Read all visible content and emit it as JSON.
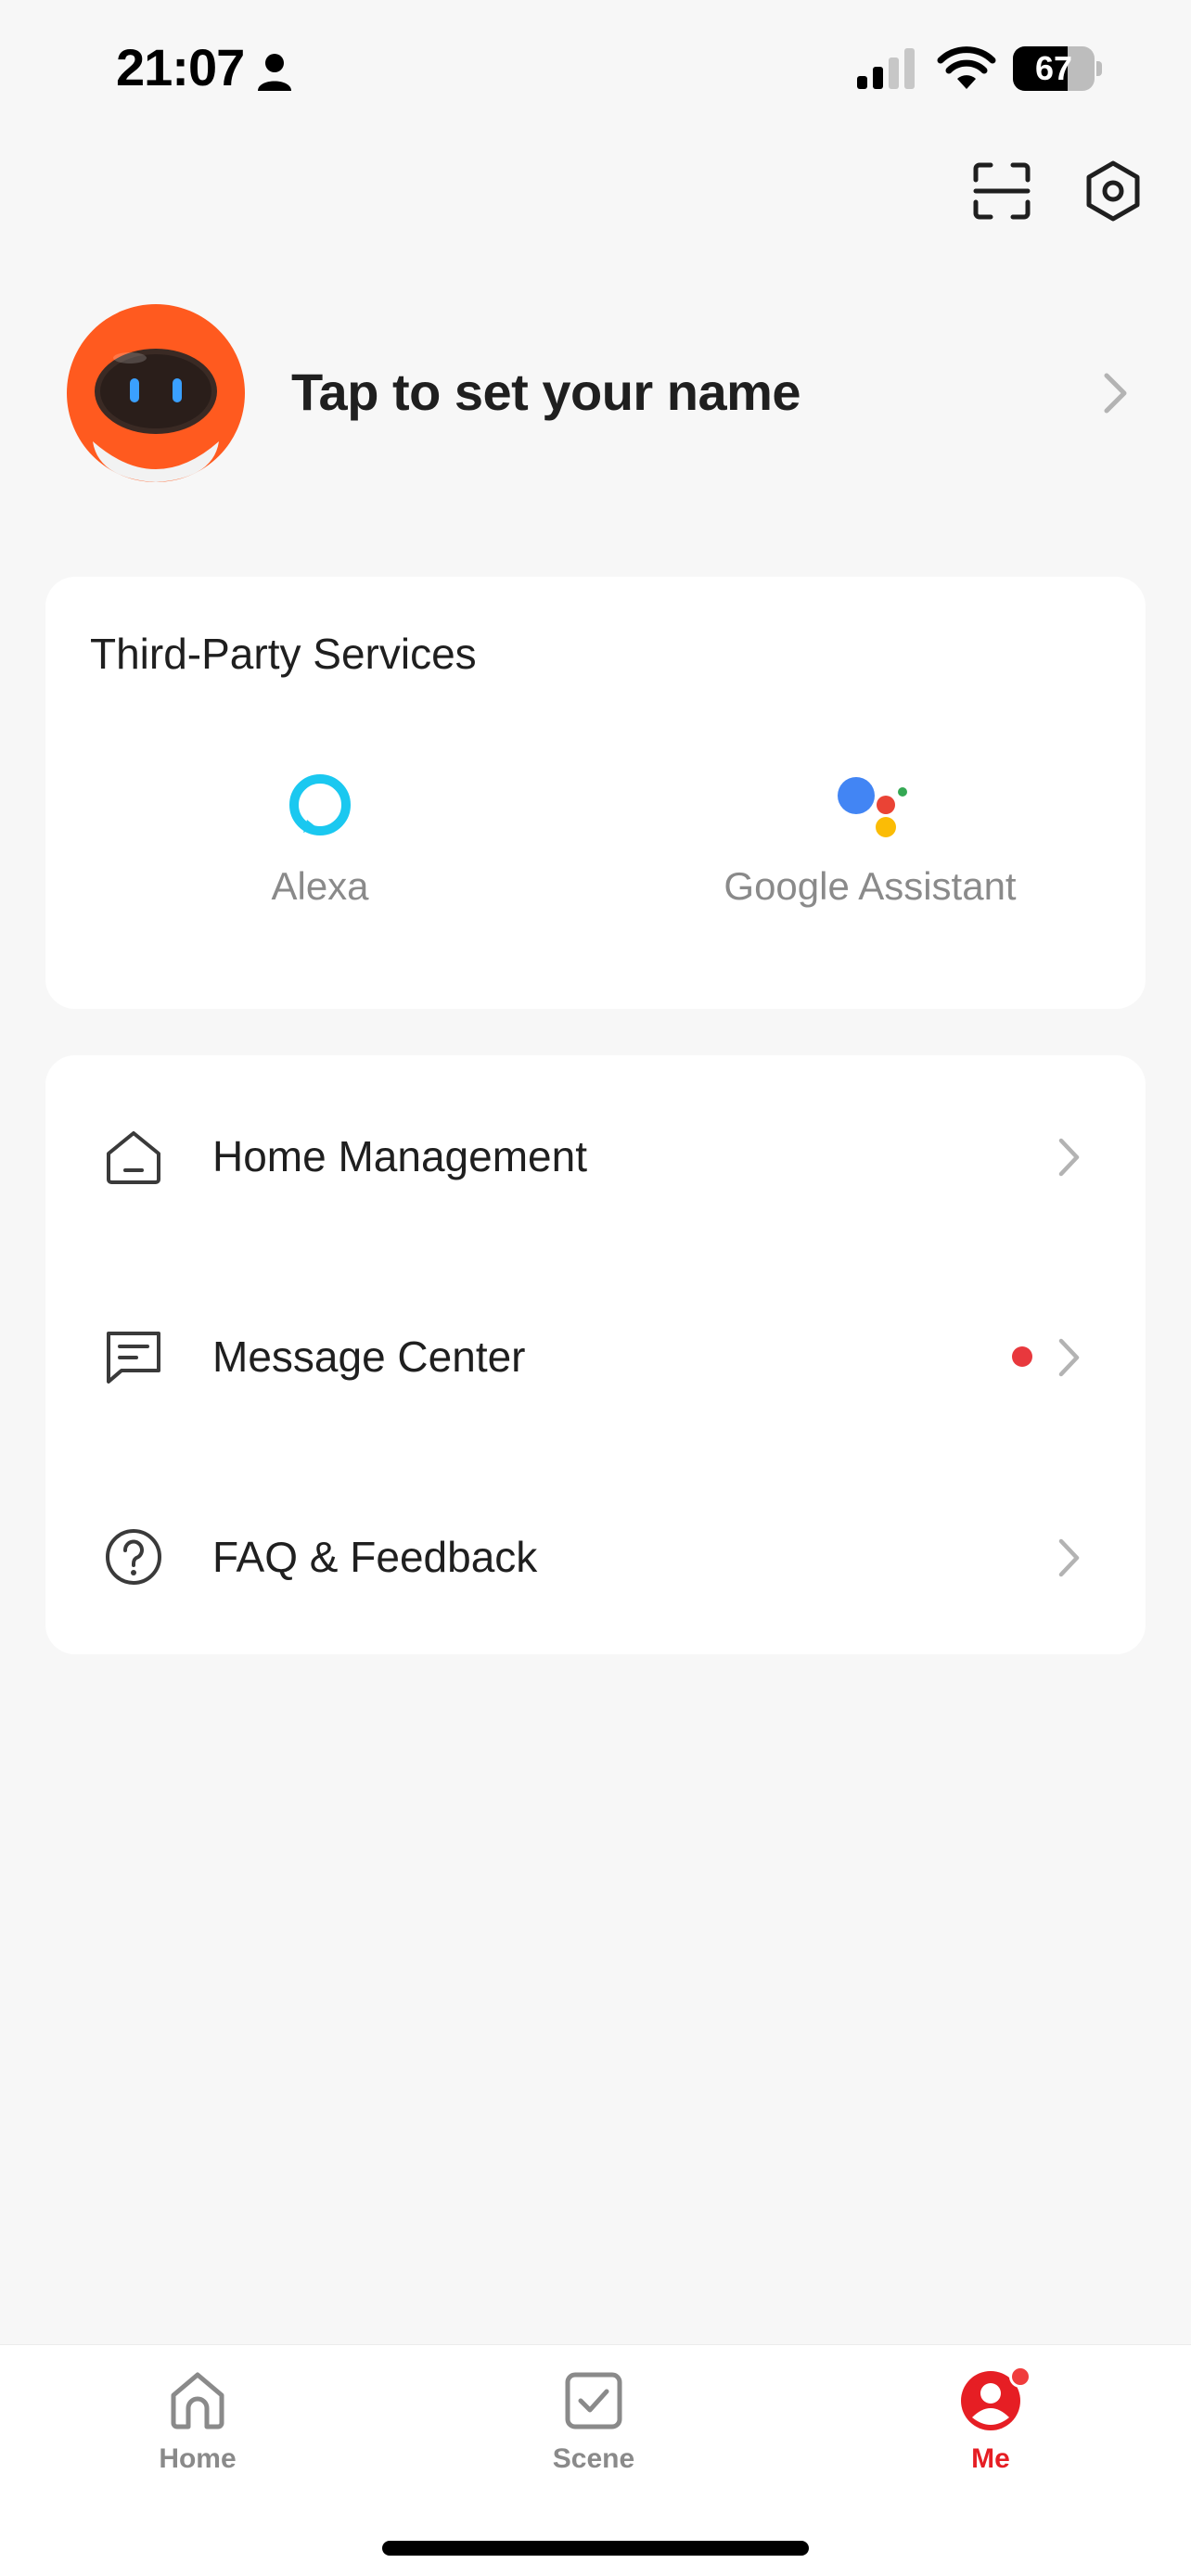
{
  "status_bar": {
    "time": "21:07",
    "battery_level": "67",
    "icons": [
      "person-icon",
      "cellular-signal-icon",
      "wifi-icon",
      "battery-icon"
    ]
  },
  "header": {
    "icons": [
      "scan-icon",
      "settings-icon"
    ]
  },
  "profile": {
    "name_prompt": "Tap to set your name",
    "avatar_icon": "robot-avatar-icon"
  },
  "third_party": {
    "title": "Third-Party Services",
    "services": [
      {
        "label": "Alexa",
        "icon": "alexa-icon"
      },
      {
        "label": "Google Assistant",
        "icon": "google-assistant-icon"
      }
    ]
  },
  "menu": {
    "items": [
      {
        "label": "Home Management",
        "icon": "house-icon",
        "has_notification": false
      },
      {
        "label": "Message Center",
        "icon": "message-icon",
        "has_notification": true
      },
      {
        "label": "FAQ & Feedback",
        "icon": "help-circle-icon",
        "has_notification": false
      }
    ]
  },
  "tab_bar": {
    "tabs": [
      {
        "label": "Home",
        "icon": "home-tab-icon",
        "active": false
      },
      {
        "label": "Scene",
        "icon": "scene-checkbox-icon",
        "active": false
      },
      {
        "label": "Me",
        "icon": "me-profile-icon",
        "active": true
      }
    ]
  },
  "colors": {
    "accent": "#e61e24",
    "notification_dot": "#e8383d",
    "background": "#f7f7f7",
    "card": "#ffffff",
    "alexa": "#1ac8f0",
    "google_blue": "#4285f4",
    "google_red": "#ea4335",
    "google_yellow": "#fbbc05",
    "google_green": "#34a853"
  }
}
